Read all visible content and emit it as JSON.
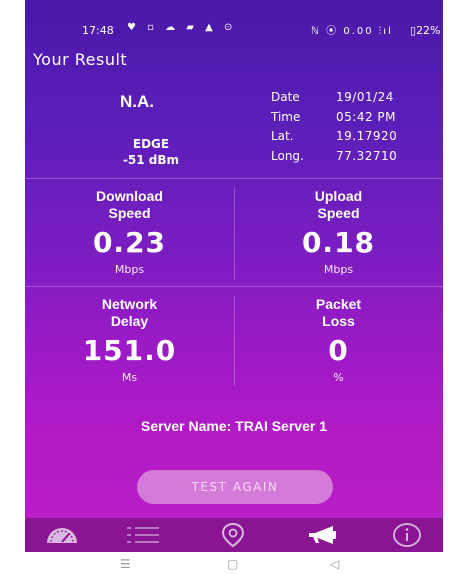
{
  "status_bar": {
    "time": "17:48",
    "left_icons": "♥ ▫ ☁ ▰ ▲ ⊙",
    "right_icons": "ℕ ⦿ 0.00 ⫶ıl",
    "speed_text": "0.00",
    "battery_text": "22%"
  },
  "header": {
    "title": "Your Result"
  },
  "info": {
    "operator": "N.A.",
    "network_type": "EDGE",
    "signal": "-51 dBm",
    "date_label": "Date",
    "date_value": "19/01/24",
    "time_label": "Time",
    "time_value": "05:42 PM",
    "lat_label": "Lat.",
    "lat_value": "19.17920",
    "long_label": "Long.",
    "long_value": "77.32710"
  },
  "metrics": {
    "download": {
      "title_line1": "Download",
      "title_line2": "Speed",
      "value": "0.23",
      "unit": "Mbps"
    },
    "upload": {
      "title_line1": "Upload",
      "title_line2": "Speed",
      "value": "0.18",
      "unit": "Mbps"
    },
    "delay": {
      "title_line1": "Network",
      "title_line2": "Delay",
      "value": "151.0",
      "unit": "Ms"
    },
    "loss": {
      "title_line1": "Packet",
      "title_line2": "Loss",
      "value": "0",
      "unit": "%"
    }
  },
  "server": {
    "text": "Server Name: TRAI Server 1"
  },
  "actions": {
    "test_again": "TEST AGAIN"
  },
  "bottom_nav": {
    "items": [
      {
        "icon": "speedometer-icon"
      },
      {
        "icon": "list-icon"
      },
      {
        "icon": "location-pin-icon"
      },
      {
        "icon": "megaphone-icon",
        "active": true
      },
      {
        "icon": "info-icon"
      }
    ]
  },
  "colors": {
    "gradient_top": "#4a18a8",
    "gradient_bottom": "#bb1fc7",
    "button": "#d47ad8",
    "nav_bar": "#8a1593"
  }
}
